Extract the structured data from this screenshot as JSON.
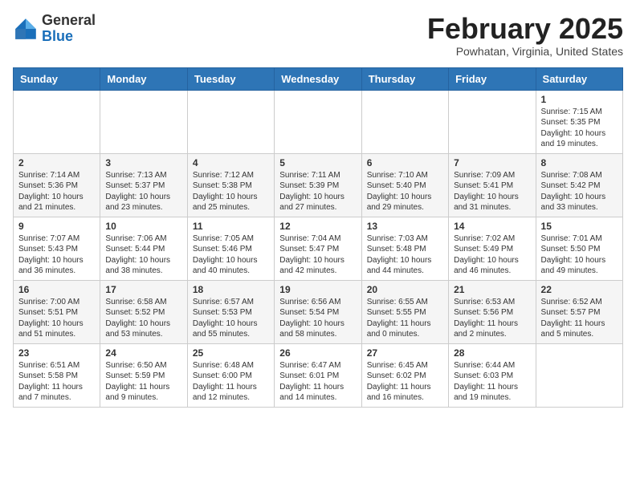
{
  "header": {
    "logo_general": "General",
    "logo_blue": "Blue",
    "month_title": "February 2025",
    "location": "Powhatan, Virginia, United States"
  },
  "weekdays": [
    "Sunday",
    "Monday",
    "Tuesday",
    "Wednesday",
    "Thursday",
    "Friday",
    "Saturday"
  ],
  "weeks": [
    [
      {
        "day": "",
        "info": ""
      },
      {
        "day": "",
        "info": ""
      },
      {
        "day": "",
        "info": ""
      },
      {
        "day": "",
        "info": ""
      },
      {
        "day": "",
        "info": ""
      },
      {
        "day": "",
        "info": ""
      },
      {
        "day": "1",
        "info": "Sunrise: 7:15 AM\nSunset: 5:35 PM\nDaylight: 10 hours and 19 minutes."
      }
    ],
    [
      {
        "day": "2",
        "info": "Sunrise: 7:14 AM\nSunset: 5:36 PM\nDaylight: 10 hours and 21 minutes."
      },
      {
        "day": "3",
        "info": "Sunrise: 7:13 AM\nSunset: 5:37 PM\nDaylight: 10 hours and 23 minutes."
      },
      {
        "day": "4",
        "info": "Sunrise: 7:12 AM\nSunset: 5:38 PM\nDaylight: 10 hours and 25 minutes."
      },
      {
        "day": "5",
        "info": "Sunrise: 7:11 AM\nSunset: 5:39 PM\nDaylight: 10 hours and 27 minutes."
      },
      {
        "day": "6",
        "info": "Sunrise: 7:10 AM\nSunset: 5:40 PM\nDaylight: 10 hours and 29 minutes."
      },
      {
        "day": "7",
        "info": "Sunrise: 7:09 AM\nSunset: 5:41 PM\nDaylight: 10 hours and 31 minutes."
      },
      {
        "day": "8",
        "info": "Sunrise: 7:08 AM\nSunset: 5:42 PM\nDaylight: 10 hours and 33 minutes."
      }
    ],
    [
      {
        "day": "9",
        "info": "Sunrise: 7:07 AM\nSunset: 5:43 PM\nDaylight: 10 hours and 36 minutes."
      },
      {
        "day": "10",
        "info": "Sunrise: 7:06 AM\nSunset: 5:44 PM\nDaylight: 10 hours and 38 minutes."
      },
      {
        "day": "11",
        "info": "Sunrise: 7:05 AM\nSunset: 5:46 PM\nDaylight: 10 hours and 40 minutes."
      },
      {
        "day": "12",
        "info": "Sunrise: 7:04 AM\nSunset: 5:47 PM\nDaylight: 10 hours and 42 minutes."
      },
      {
        "day": "13",
        "info": "Sunrise: 7:03 AM\nSunset: 5:48 PM\nDaylight: 10 hours and 44 minutes."
      },
      {
        "day": "14",
        "info": "Sunrise: 7:02 AM\nSunset: 5:49 PM\nDaylight: 10 hours and 46 minutes."
      },
      {
        "day": "15",
        "info": "Sunrise: 7:01 AM\nSunset: 5:50 PM\nDaylight: 10 hours and 49 minutes."
      }
    ],
    [
      {
        "day": "16",
        "info": "Sunrise: 7:00 AM\nSunset: 5:51 PM\nDaylight: 10 hours and 51 minutes."
      },
      {
        "day": "17",
        "info": "Sunrise: 6:58 AM\nSunset: 5:52 PM\nDaylight: 10 hours and 53 minutes."
      },
      {
        "day": "18",
        "info": "Sunrise: 6:57 AM\nSunset: 5:53 PM\nDaylight: 10 hours and 55 minutes."
      },
      {
        "day": "19",
        "info": "Sunrise: 6:56 AM\nSunset: 5:54 PM\nDaylight: 10 hours and 58 minutes."
      },
      {
        "day": "20",
        "info": "Sunrise: 6:55 AM\nSunset: 5:55 PM\nDaylight: 11 hours and 0 minutes."
      },
      {
        "day": "21",
        "info": "Sunrise: 6:53 AM\nSunset: 5:56 PM\nDaylight: 11 hours and 2 minutes."
      },
      {
        "day": "22",
        "info": "Sunrise: 6:52 AM\nSunset: 5:57 PM\nDaylight: 11 hours and 5 minutes."
      }
    ],
    [
      {
        "day": "23",
        "info": "Sunrise: 6:51 AM\nSunset: 5:58 PM\nDaylight: 11 hours and 7 minutes."
      },
      {
        "day": "24",
        "info": "Sunrise: 6:50 AM\nSunset: 5:59 PM\nDaylight: 11 hours and 9 minutes."
      },
      {
        "day": "25",
        "info": "Sunrise: 6:48 AM\nSunset: 6:00 PM\nDaylight: 11 hours and 12 minutes."
      },
      {
        "day": "26",
        "info": "Sunrise: 6:47 AM\nSunset: 6:01 PM\nDaylight: 11 hours and 14 minutes."
      },
      {
        "day": "27",
        "info": "Sunrise: 6:45 AM\nSunset: 6:02 PM\nDaylight: 11 hours and 16 minutes."
      },
      {
        "day": "28",
        "info": "Sunrise: 6:44 AM\nSunset: 6:03 PM\nDaylight: 11 hours and 19 minutes."
      },
      {
        "day": "",
        "info": ""
      }
    ]
  ]
}
